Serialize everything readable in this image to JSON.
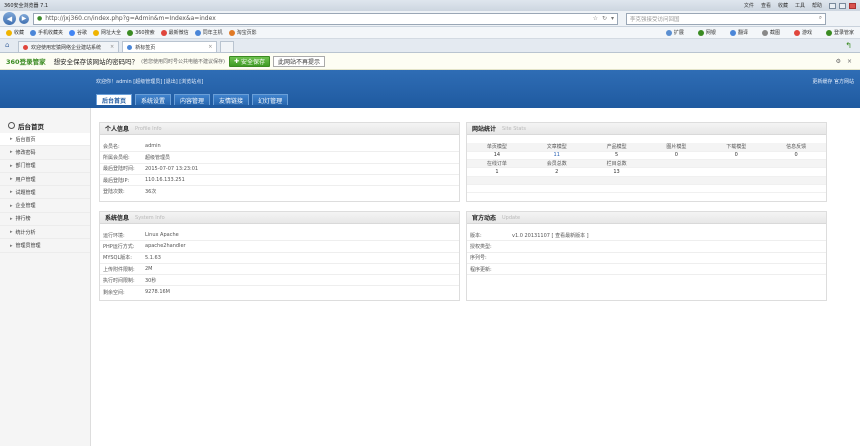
{
  "browser": {
    "title": "360安全浏览器 7.1",
    "menus": [
      "文件",
      "查看",
      "收藏",
      "工具",
      "帮助"
    ],
    "url": "http://jxj360.cn/index.php?g=Admin&m=Index&a=index",
    "search_placeholder": "李克强接受访问回国",
    "favorites": [
      "收藏",
      "手机收藏夹",
      "谷歌",
      "网址大全",
      "360搜索",
      "最新微信",
      "同年主机",
      "淘宝页影"
    ],
    "fav_right": [
      "扩展",
      "网银",
      "翻译",
      "截图",
      "游戏",
      "登录管家"
    ],
    "tabs": [
      {
        "label": "欢迎使用宏猿网络企业建站系统",
        "active": false
      },
      {
        "label": "新标签页",
        "active": true
      }
    ]
  },
  "notice": {
    "brand": "360登录管家",
    "message": "想安全保存该网站的密码吗？",
    "sub": "(若您使用同时号公共电脑不建议保存)",
    "save_label": "安全保存",
    "never_label": "此网站不再提示"
  },
  "header": {
    "info": "欢迎你！admin [超级管理员] [退出] [浏览站点]",
    "right_links": "更新缓存  官方网站",
    "nav": [
      {
        "label": "后台首页",
        "active": true
      },
      {
        "label": "系统设置",
        "active": false
      },
      {
        "label": "内容管理",
        "active": false
      },
      {
        "label": "友情链接",
        "active": false
      },
      {
        "label": "幻灯管理",
        "active": false
      }
    ]
  },
  "sidebar": {
    "heading": "后台首页",
    "items": [
      {
        "label": "后台首页",
        "active": true
      },
      {
        "label": "修改密码",
        "active": false
      },
      {
        "label": "部门管理",
        "active": false
      },
      {
        "label": "用户管理",
        "active": false
      },
      {
        "label": "试题管理",
        "active": false
      },
      {
        "label": "企业管理",
        "active": false
      },
      {
        "label": "排行榜",
        "active": false
      },
      {
        "label": "统计分析",
        "active": false
      },
      {
        "label": "管理员管理",
        "active": false
      }
    ]
  },
  "personal": {
    "title": "个人信息",
    "title_en": "Profile Info",
    "rows": [
      {
        "k": "会员名:",
        "v": "admin"
      },
      {
        "k": "所属会员组:",
        "v": "超级管理员"
      },
      {
        "k": "最后登陆时间:",
        "v": "2015-07-07 13:23:01"
      },
      {
        "k": "最后登陆IP:",
        "v": "110.16.133.251"
      },
      {
        "k": "登陆次数:",
        "v": "36次"
      }
    ]
  },
  "stats": {
    "title": "网站统计",
    "title_en": "Site Stats",
    "row1_labels": [
      "单页模型",
      "文章模型",
      "产品模型",
      "图片模型",
      "下载模型",
      "信息反馈"
    ],
    "row1_values": [
      "14",
      "11",
      "5",
      "0",
      "0",
      "0"
    ],
    "row2_labels": [
      "在线订单",
      "会员总数",
      "栏目总数"
    ],
    "row2_values": [
      "1",
      "2",
      "13"
    ]
  },
  "system": {
    "title": "系统信息",
    "title_en": "System Info",
    "rows": [
      {
        "k": "运行环境:",
        "v": "Linux Apache"
      },
      {
        "k": "PHP运行方式:",
        "v": "apache2handler"
      },
      {
        "k": "MYSQL版本:",
        "v": "5.1.63"
      },
      {
        "k": "上传附件限制:",
        "v": "2M"
      },
      {
        "k": "执行时间限制:",
        "v": "30秒"
      },
      {
        "k": "剩余空间:",
        "v": "9278.16M"
      }
    ]
  },
  "updates": {
    "title": "官方动态",
    "title_en": "Update",
    "rows": [
      {
        "k": "版本:",
        "v": "v1.0 20131107 [ 查看最新版本 ]"
      },
      {
        "k": "授权类型:",
        "v": ""
      },
      {
        "k": "序列号:",
        "v": ""
      },
      {
        "k": "程序更新:",
        "v": ""
      }
    ]
  }
}
